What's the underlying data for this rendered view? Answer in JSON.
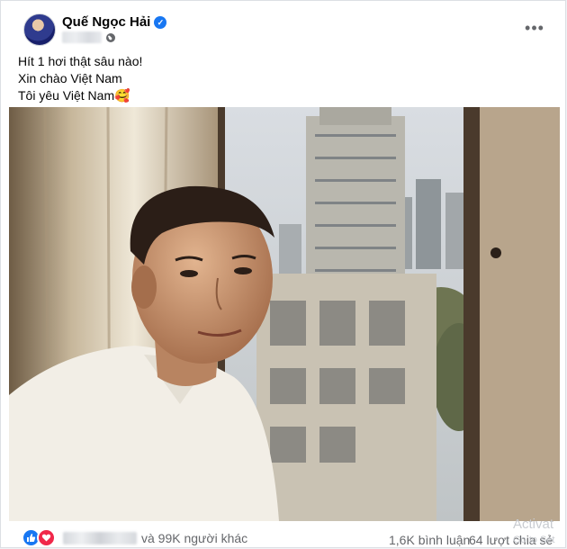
{
  "post": {
    "author_name": "Quế Ngọc Hải",
    "lines": [
      "Hít 1 hơi thật sâu nào!",
      "Xin chào Việt Nam",
      "Tôi yêu Việt Nam🥰"
    ]
  },
  "icons": {
    "verified": "verified-badge-icon",
    "audience": "globe-icon",
    "more": "more-options-icon",
    "like": "like-reaction-icon",
    "love": "love-reaction-icon"
  },
  "footer": {
    "reaction_summary": "và 99K người khác",
    "comments": "1,6K bình luận",
    "shares": "64 lượt chia sẻ"
  },
  "overlay": {
    "activate_line1": "Activat",
    "activate_line2": "Go to Set"
  },
  "colors": {
    "brand_blue": "#1877f2",
    "love_red": "#f0284a",
    "secondary_text": "#65676b"
  }
}
